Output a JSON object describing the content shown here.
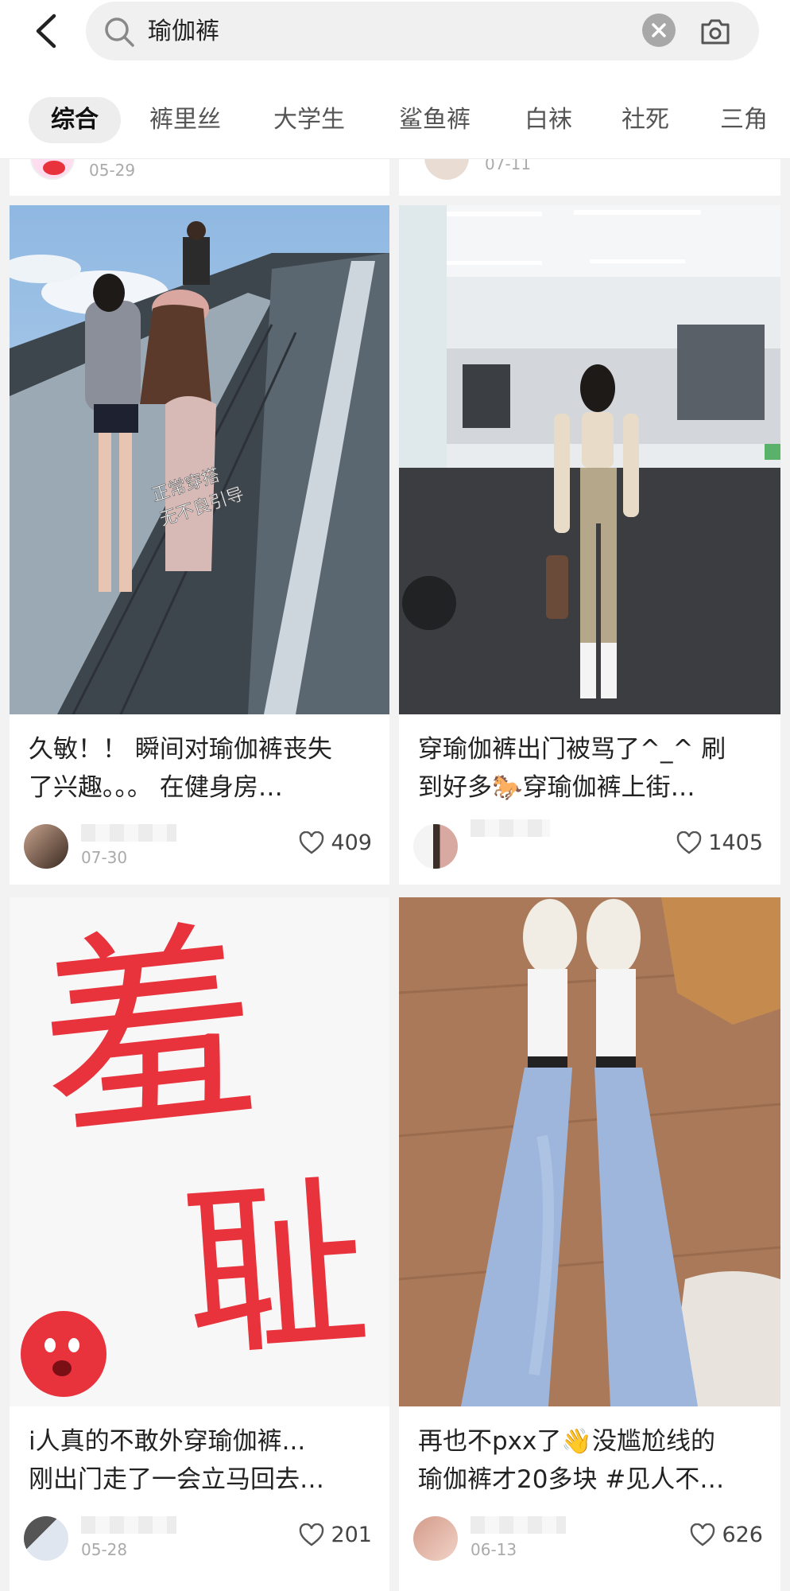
{
  "search": {
    "query": "瑜伽裤"
  },
  "tabs": [
    "综合",
    "裤里丝",
    "大学生",
    "鲨鱼裤",
    "白袜",
    "社死",
    "三角"
  ],
  "top_partial": [
    {
      "date": "05-29"
    },
    {
      "date": "07-11"
    }
  ],
  "cards": [
    {
      "overlay_text": [
        "正常穿搭",
        "无不良引导"
      ],
      "title_lines": [
        "久敏！！ 瞬间对瑜伽裤丧失",
        "了兴趣。。。 在健身房…"
      ],
      "date": "07-30",
      "likes": "409"
    },
    {
      "title_lines": [
        "穿瑜伽裤出门被骂了^_^ 刷",
        "到好多🐎穿瑜伽裤上街…"
      ],
      "date": "",
      "likes": "1405"
    },
    {
      "image_text": [
        "羞",
        "耻"
      ],
      "title_lines": [
        "i人真的不敢外穿瑜伽裤...",
        "刚出门走了一会立马回去…"
      ],
      "date": "05-28",
      "likes": "201"
    },
    {
      "title_lines": [
        "再也不pxx了👋没尴尬线的",
        "瑜伽裤才20多块 #见人不…"
      ],
      "date": "06-13",
      "likes": "626"
    }
  ],
  "colors": {
    "accent_red": "#e8323c",
    "text_dark": "#222222"
  }
}
